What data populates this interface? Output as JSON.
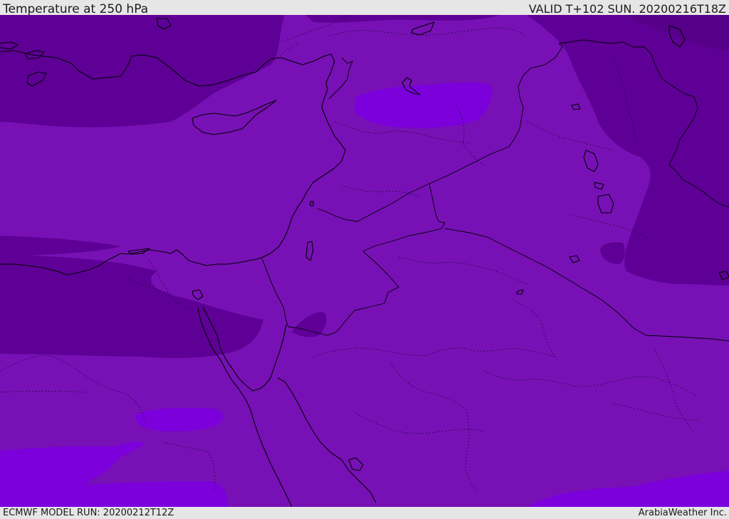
{
  "header": {
    "title": "Temperature at 250 hPa",
    "valid_time": "VALID T+102 SUN. 20200216T18Z"
  },
  "footer": {
    "model_run": "ECMWF MODEL RUN: 20200212T12Z",
    "credit": "ArabiaWeather Inc."
  },
  "map": {
    "field": "Temperature at 250 hPa",
    "colors": {
      "base_band": "#7711b5",
      "cold_band": "#5e0096",
      "warm_band": "#7b00dc",
      "coastline": "#000000",
      "border": "#000000"
    },
    "regions_depicted": [
      "Eastern Mediterranean",
      "Levant",
      "Egypt",
      "Sinai",
      "Red Sea",
      "Arabian Peninsula (north)",
      "Iraq",
      "Iran (west)",
      "Turkey (south)",
      "Cyprus"
    ]
  }
}
